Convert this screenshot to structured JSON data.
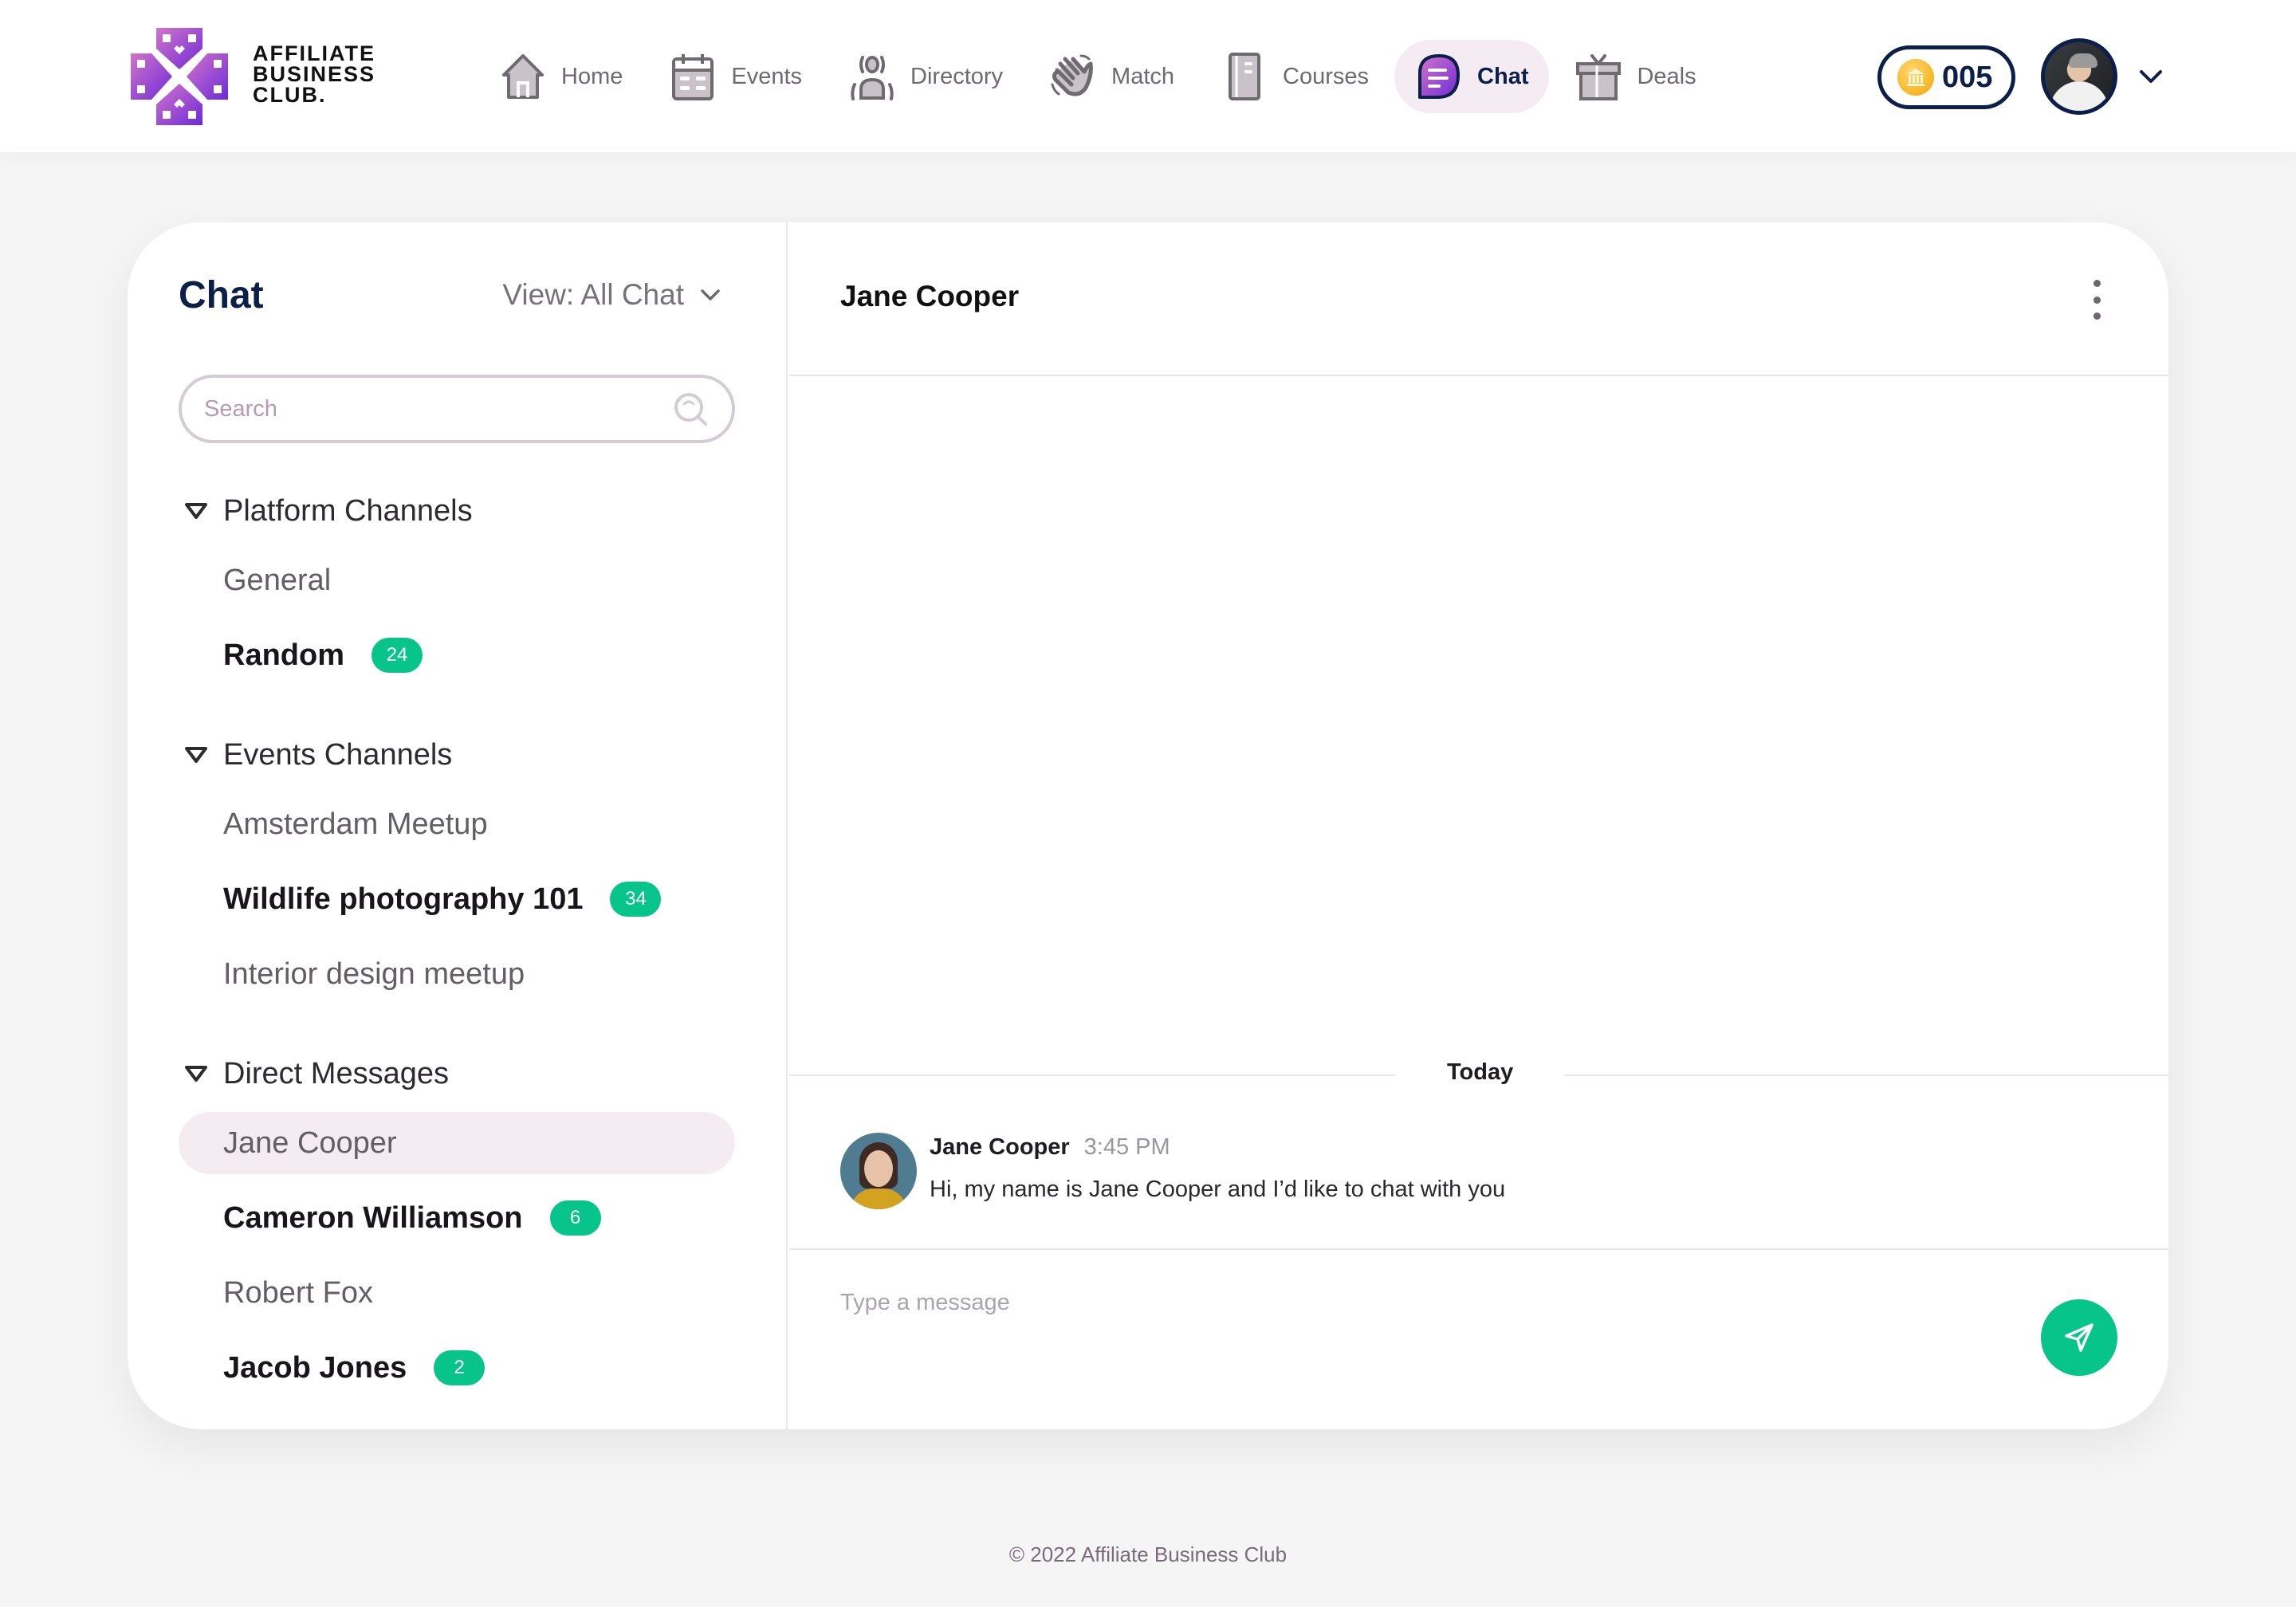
{
  "brand": {
    "name_lines": [
      "AFFILIATE",
      "BUSINESS",
      "CLUB."
    ],
    "logo_icon": "affiliate-club-logo",
    "colors": {
      "primary": "#0b1f48",
      "accent_gradient_start": "#d374c9",
      "accent_gradient_end": "#6c2bd9",
      "success": "#06c48a"
    }
  },
  "nav": {
    "items": [
      {
        "label": "Home",
        "icon": "home-icon",
        "active": false
      },
      {
        "label": "Events",
        "icon": "calendar-icon",
        "active": false
      },
      {
        "label": "Directory",
        "icon": "directory-icon",
        "active": false
      },
      {
        "label": "Match",
        "icon": "waving-hand-icon",
        "active": false
      },
      {
        "label": "Courses",
        "icon": "book-icon",
        "active": false
      },
      {
        "label": "Chat",
        "icon": "chat-bubble-icon",
        "active": true
      },
      {
        "label": "Deals",
        "icon": "gift-icon",
        "active": false
      }
    ]
  },
  "account": {
    "coin_count": "005",
    "coin_icon": "bank-coin-icon",
    "avatar": "user-avatar",
    "menu_icon": "chevron-down-icon"
  },
  "sidebar": {
    "title": "Chat",
    "view_label": "View: All Chat",
    "search_placeholder": "Search",
    "groups": [
      {
        "label": "Platform Channels",
        "items": [
          {
            "label": "General",
            "unread": null,
            "bold": false,
            "selected": false
          },
          {
            "label": "Random",
            "unread": "24",
            "bold": true,
            "selected": false
          }
        ]
      },
      {
        "label": "Events Channels",
        "items": [
          {
            "label": "Amsterdam Meetup",
            "unread": null,
            "bold": false,
            "selected": false
          },
          {
            "label": "Wildlife photography 101",
            "unread": "34",
            "bold": true,
            "selected": false
          },
          {
            "label": "Interior design meetup",
            "unread": null,
            "bold": false,
            "selected": false
          }
        ]
      },
      {
        "label": "Direct Messages",
        "items": [
          {
            "label": "Jane Cooper",
            "unread": null,
            "bold": false,
            "selected": true
          },
          {
            "label": "Cameron Williamson",
            "unread": "6",
            "bold": true,
            "selected": false
          },
          {
            "label": "Robert Fox",
            "unread": null,
            "bold": false,
            "selected": false
          },
          {
            "label": "Jacob Jones",
            "unread": "2",
            "bold": true,
            "selected": false
          }
        ]
      }
    ]
  },
  "conversation": {
    "title": "Jane Cooper",
    "day_label": "Today",
    "messages": [
      {
        "author": "Jane Cooper",
        "time": "3:45 PM",
        "text": "Hi, my name is Jane Cooper and I’d like to chat with you"
      }
    ],
    "composer_placeholder": "Type a message"
  },
  "footer": {
    "text": "© 2022 Affiliate Business Club"
  }
}
